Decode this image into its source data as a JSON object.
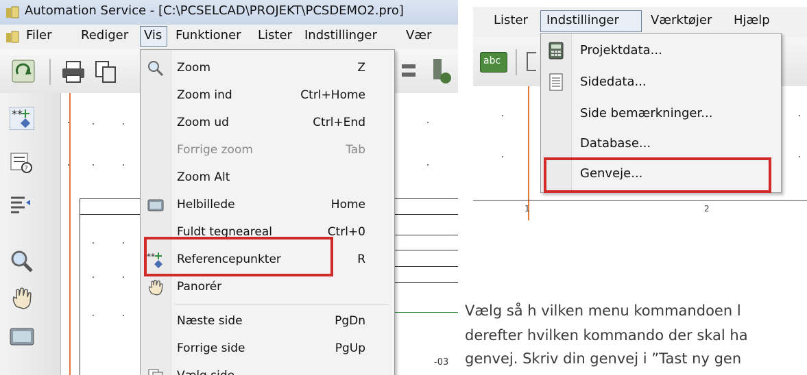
{
  "left_window": {
    "title": "Automation Service - [C:\\PCSELCAD\\PROJEKT\\PCSDEMO2.pro]",
    "menubar": [
      "Filer",
      "Rediger",
      "Vis",
      "Funktioner",
      "Lister",
      "Indstillinger",
      "Værktøjer"
    ],
    "menubar_visible": [
      "Filer",
      "Rediger",
      "Vis",
      "Funktioner",
      "Lister",
      "Indstillinger",
      "Vær"
    ],
    "vis_menu": [
      {
        "label": "Zoom",
        "shortcut": "Z",
        "icon": "magnifier-icon"
      },
      {
        "label": "Zoom ind",
        "shortcut": "Ctrl+Home"
      },
      {
        "label": "Zoom ud",
        "shortcut": "Ctrl+End"
      },
      {
        "label": "Forrige zoom",
        "shortcut": "Tab",
        "disabled": true
      },
      {
        "label": "Zoom Alt",
        "shortcut": ""
      },
      {
        "label": "Helbillede",
        "shortcut": "Home",
        "icon": "monitor-icon"
      },
      {
        "label": "Fuldt tegneareal",
        "shortcut": "Ctrl+0"
      },
      {
        "label": "Referencepunkter",
        "shortcut": "R",
        "icon": "reference-point-icon",
        "highlighted": true
      },
      {
        "label": "Panorér",
        "shortcut": "",
        "icon": "hand-icon"
      },
      {
        "label": "Næste side",
        "shortcut": "PgDn"
      },
      {
        "label": "Forrige side",
        "shortcut": "PgUp"
      },
      {
        "label": "Vælg side...",
        "shortcut": "",
        "icon": "page-icon"
      }
    ],
    "coordinate_text": "-03"
  },
  "right_window": {
    "menubar": [
      "Lister",
      "Indstillinger",
      "Værktøjer",
      "Hjælp"
    ],
    "indstillinger_menu": [
      {
        "label": "Projektdata...",
        "icon": "calculator-icon"
      },
      {
        "label": "Sidedata...",
        "icon": "document-icon"
      },
      {
        "label": "Side bemærkninger..."
      },
      {
        "label": "Database..."
      },
      {
        "label": "Genveje...",
        "highlighted": true
      }
    ],
    "ruler": [
      "1",
      "2"
    ],
    "toolbar_text_icon": "abc"
  },
  "instructions": {
    "line1": "Vælg så h vilken menu kommandoen l",
    "line2": "derefter hvilken kommando der skal ha",
    "line3": "genvej. Skriv din genvej i ”Tast ny gen"
  },
  "colors": {
    "highlight_box": "#d02a2a",
    "orange_guide": "#e07a3a",
    "green_line": "#2f8a3a"
  }
}
